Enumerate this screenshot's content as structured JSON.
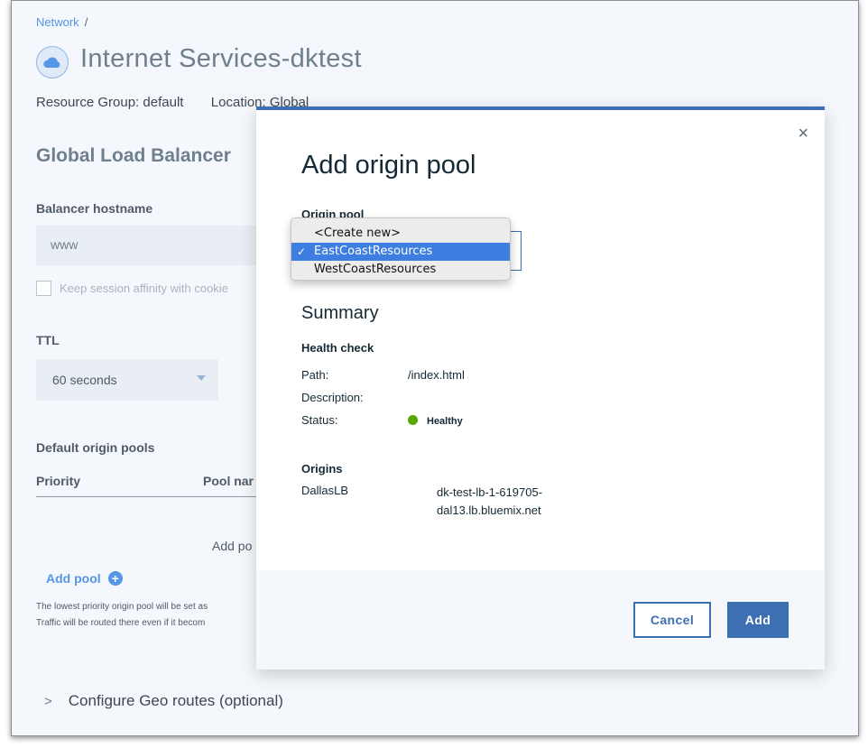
{
  "breadcrumb": {
    "item": "Network",
    "separator": "/"
  },
  "header": {
    "title": "Internet Services-dktest",
    "resource_group_label": "Resource Group:",
    "resource_group_value": "default",
    "location_label": "Location:",
    "location_value": "Global"
  },
  "page": {
    "section_title": "Global Load Balancer",
    "hostname_label": "Balancer hostname",
    "hostname_value": "www",
    "session_affinity_label": "Keep session affinity with cookie",
    "ttl_label": "TTL",
    "ttl_value": "60 seconds",
    "default_pools_title": "Default origin pools",
    "col_priority": "Priority",
    "col_pool_name": "Pool nar",
    "add_pool_placeholder": "Add po",
    "add_pool_link": "Add pool",
    "note_line1": "The lowest priority origin pool will be set as",
    "note_line2": "Traffic will be routed there even if it becom",
    "geo_routes": "Configure Geo routes (optional)"
  },
  "modal": {
    "title": "Add origin pool",
    "close_symbol": "×",
    "origin_pool_label": "Origin pool",
    "dropdown_options": [
      "<Create new>",
      "EastCoastResources",
      "WestCoastResources"
    ],
    "selected_option": "EastCoastResources",
    "check_mark": "✓",
    "summary_title": "Summary",
    "health_check_title": "Health check",
    "path_label": "Path:",
    "path_value": "/index.html",
    "description_label": "Description:",
    "description_value": "",
    "status_label": "Status:",
    "status_value": "Healthy",
    "status_color": "#5aa700",
    "origins_title": "Origins",
    "origin_name": "DallasLB",
    "origin_host_line1": "dk-test-lb-1-619705-",
    "origin_host_line2": "dal13.lb.bluemix.net",
    "cancel_label": "Cancel",
    "add_label": "Add"
  },
  "colors": {
    "accent": "#3d70b2",
    "link": "#5596e6"
  },
  "icons": {
    "service": "cloud-icon",
    "add": "plus-circle-icon",
    "expand": "chevron-right-icon"
  }
}
